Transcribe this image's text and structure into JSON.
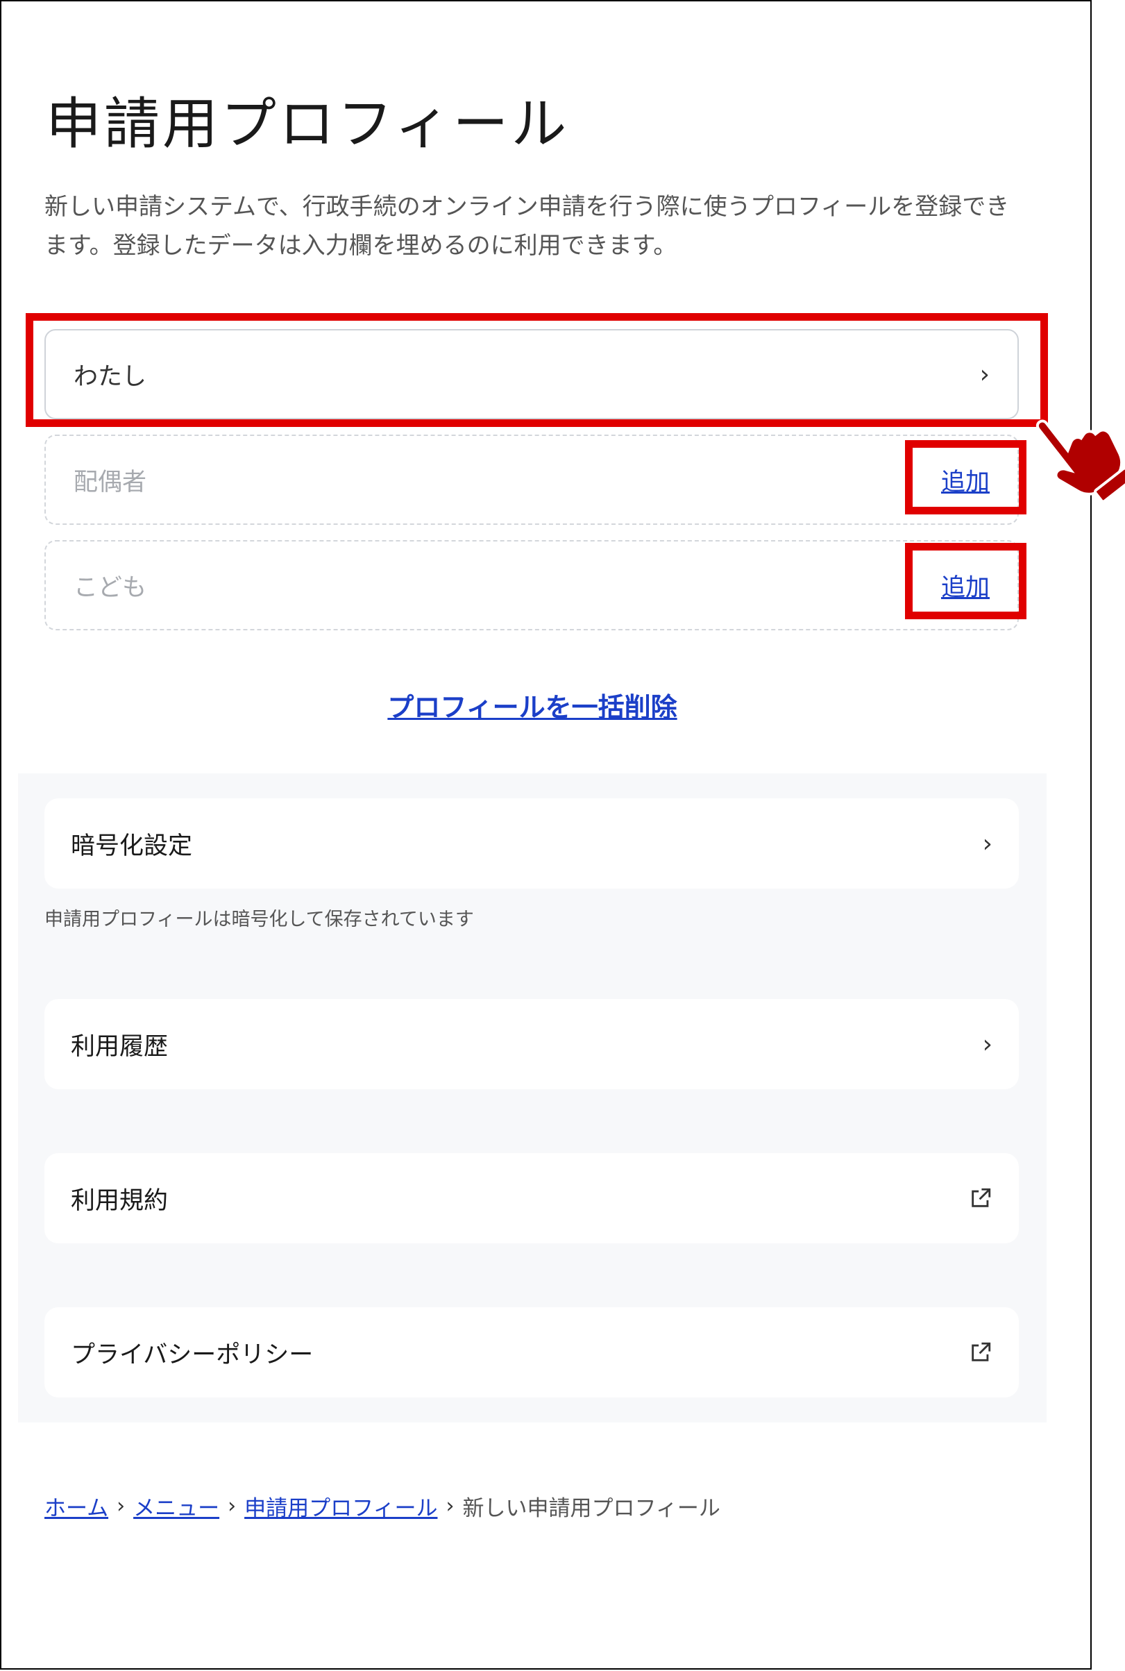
{
  "page": {
    "title": "申請用プロフィール",
    "description": "新しい申請システムで、行政手続のオンライン申請を行う際に使うプロフィールを登録できます。登録したデータは入力欄を埋めるのに利用できます。"
  },
  "profiles": {
    "me": {
      "label": "わたし"
    },
    "spouse": {
      "label": "配偶者",
      "action": "追加"
    },
    "child": {
      "label": "こども",
      "action": "追加"
    }
  },
  "bulk_delete": {
    "label": "プロフィールを一括削除"
  },
  "settings": {
    "encryption": {
      "label": "暗号化設定",
      "note": "申請用プロフィールは暗号化して保存されています"
    },
    "history": {
      "label": "利用履歴"
    },
    "terms": {
      "label": "利用規約"
    },
    "privacy": {
      "label": "プライバシーポリシー"
    }
  },
  "breadcrumb": {
    "home": "ホーム",
    "menu": "メニュー",
    "profile": "申請用プロフィール",
    "current": "新しい申請用プロフィール"
  },
  "colors": {
    "link": "#1b3fc8",
    "highlight": "#e00000",
    "hand": "#b00000"
  },
  "icons": {
    "chevron": "chevron-right-icon",
    "external": "external-link-icon",
    "pointer": "pointing-hand-icon"
  }
}
